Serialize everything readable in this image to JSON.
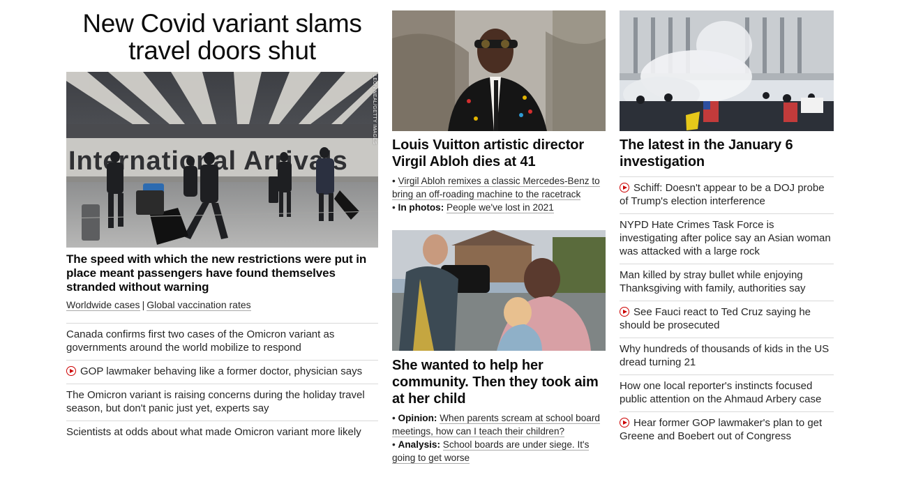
{
  "colors": {
    "accent": "#cc0000",
    "text": "#0c0c0c",
    "rule": "#d9d9d9"
  },
  "col1": {
    "headline": [
      "New Covid variant slams",
      "travel doors shut"
    ],
    "image": {
      "sign_text": "International Arrivals",
      "credit": "LEON NEAL/GETTY IMAGES"
    },
    "lede": "The speed with which the new restrictions were put in place meant passengers have found themselves stranded without warning",
    "sublinks": [
      "Worldwide cases",
      "Global vaccination rates"
    ],
    "sublink_sep": "|",
    "list": [
      {
        "video": false,
        "text": "Canada confirms first two cases of the Omicron variant as governments around the world mobilize to respond"
      },
      {
        "video": true,
        "text": "GOP lawmaker behaving like a former doctor, physician says"
      },
      {
        "video": false,
        "text": "The Omicron variant is raising concerns during the holiday travel season, but don't panic just yet, experts say"
      },
      {
        "video": false,
        "text": "Scientists at odds about what made Omicron variant more likely"
      }
    ]
  },
  "col2": {
    "card1": {
      "headline": "Louis Vuitton artistic director Virgil Abloh dies at 41",
      "bullets": [
        {
          "label": "",
          "text": "Virgil Abloh remixes a classic Mercedes-Benz to bring an off-roading machine to the racetrack"
        },
        {
          "label": "In photos:",
          "text": "People we've lost in 2021"
        }
      ]
    },
    "card2": {
      "headline": "She wanted to help her community. Then they took aim at her child",
      "bullets": [
        {
          "label": "Opinion:",
          "text": "When parents scream at school board meetings, how can I teach their children?"
        },
        {
          "label": "Analysis:",
          "text": "School boards are under siege. It's going to get worse"
        }
      ]
    }
  },
  "col3": {
    "headline": "The latest in the January 6 investigation",
    "list": [
      {
        "video": true,
        "text": "Schiff: Doesn't appear to be a DOJ probe of Trump's election interference"
      },
      {
        "video": false,
        "text": "NYPD Hate Crimes Task Force is investigating after police say an Asian woman was attacked with a large rock"
      },
      {
        "video": false,
        "text": "Man killed by stray bullet while enjoying Thanksgiving with family, authorities say"
      },
      {
        "video": true,
        "text": "See Fauci react to Ted Cruz saying he should be prosecuted"
      },
      {
        "video": false,
        "text": "Why hundreds of thousands of kids in the US dread turning 21"
      },
      {
        "video": false,
        "text": "How one local reporter's instincts focused public attention on the Ahmaud Arbery case"
      },
      {
        "video": true,
        "text": "Hear former GOP lawmaker's plan to get Greene and Boebert out of Congress"
      }
    ]
  }
}
